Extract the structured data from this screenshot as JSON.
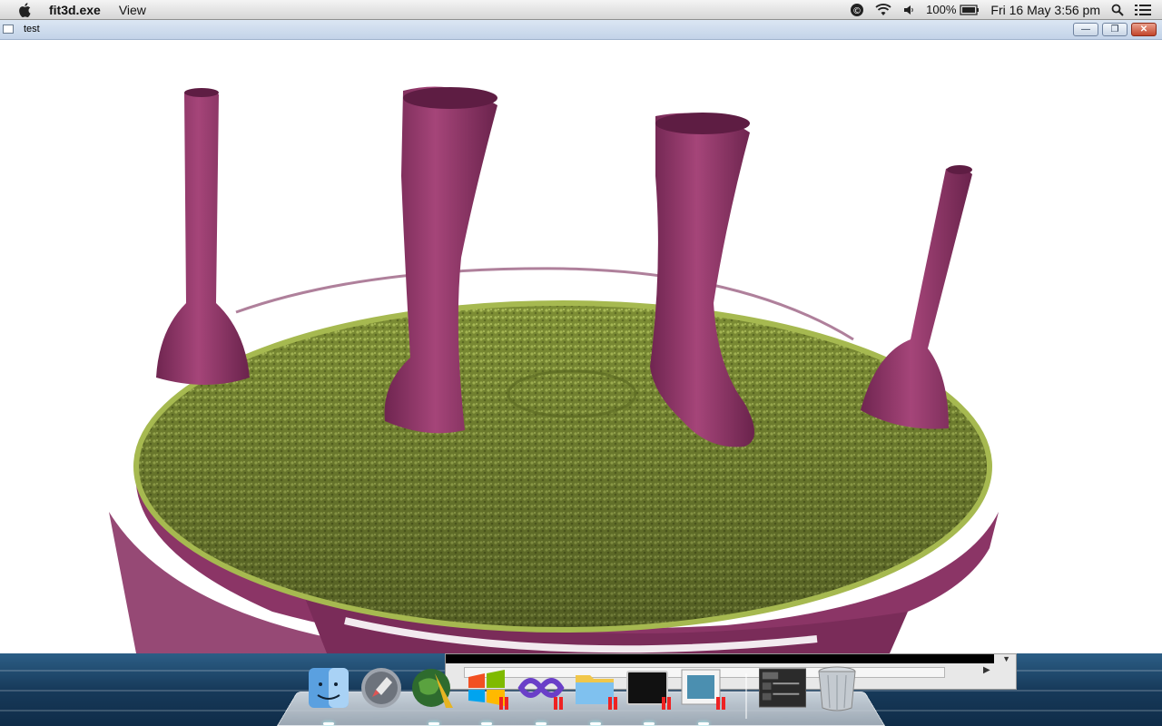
{
  "menubar": {
    "app_name": "fit3d.exe",
    "menu_view": "View",
    "battery": "100%",
    "datetime": "Fri 16 May  3:56 pm",
    "icons": [
      "apple-icon",
      "sync-icon",
      "wifi-icon",
      "volume-icon",
      "battery-icon",
      "spotlight-icon",
      "notification-list-icon"
    ]
  },
  "window": {
    "title": "test",
    "minimize": "—",
    "restore": "❐",
    "close": "✕"
  },
  "scene": {
    "description_colors": {
      "base_green": "#8e9e3e",
      "mesh_purple": "#8b3566",
      "background": "#ffffff"
    }
  },
  "dock": {
    "items": [
      {
        "name": "finder-icon"
      },
      {
        "name": "launchpad-icon"
      },
      {
        "name": "globe-app-icon"
      },
      {
        "name": "windows-icon"
      },
      {
        "name": "visual-studio-icon"
      },
      {
        "name": "folder-icon"
      },
      {
        "name": "terminal-icon"
      },
      {
        "name": "preview-icon"
      },
      {
        "name": "stack-thumbnail-icon"
      },
      {
        "name": "trash-icon"
      }
    ],
    "indicators": [
      "||",
      "||",
      "||",
      "||",
      "||"
    ]
  }
}
